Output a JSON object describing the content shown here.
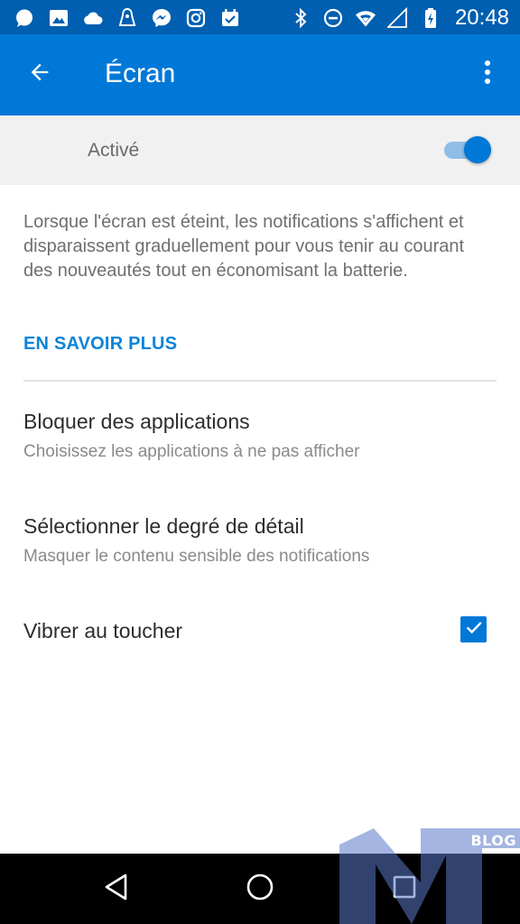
{
  "status_bar": {
    "time": "20:48",
    "left_icons": [
      "whatsapp-icon",
      "gallery-icon",
      "cloud-icon",
      "app-icon",
      "messenger-icon",
      "instagram-icon",
      "calendar-check-icon"
    ],
    "right_icons": [
      "bluetooth-icon",
      "do-not-disturb-icon",
      "wifi-icon",
      "signal-icon",
      "battery-charging-icon"
    ]
  },
  "app_bar": {
    "title": "Écran",
    "color": "#0078d7"
  },
  "master_switch": {
    "label": "Activé",
    "state": "on"
  },
  "description": "Lorsque l'écran est éteint, les notifications s'affichent et disparaissent graduellement pour vous tenir au courant des nouveautés tout en économisant la batterie.",
  "learn_more": "EN SAVOIR PLUS",
  "settings": [
    {
      "title": "Bloquer des applications",
      "subtitle": "Choisissez les applications à ne pas afficher"
    },
    {
      "title": "Sélectionner le degré de détail",
      "subtitle": "Masquer le contenu sensible des notifications"
    },
    {
      "title": "Vibrer au toucher",
      "checked": true
    }
  ],
  "watermark": {
    "text": "BLOG"
  }
}
